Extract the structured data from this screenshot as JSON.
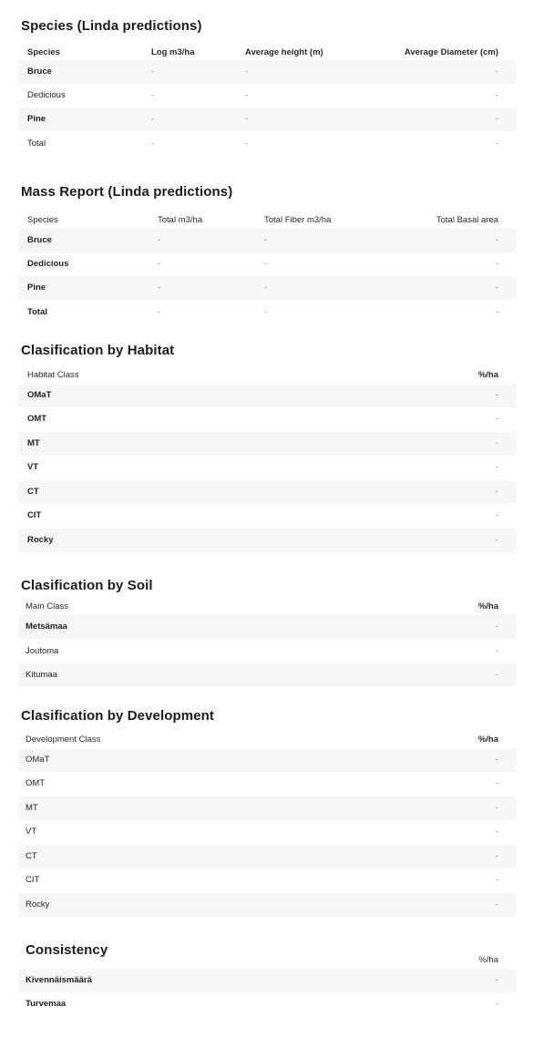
{
  "species": {
    "title": "Species (Linda predictions)",
    "headers": [
      "Species",
      "Log m3/ha",
      "Average height (m)",
      "Average Diameter (cm)"
    ],
    "rows": [
      {
        "label": "Bruce",
        "c1": "-",
        "c2": "-",
        "c3": "-"
      },
      {
        "label": "Dedicious",
        "c1": "-",
        "c2": "-",
        "c3": "-"
      },
      {
        "label": "Pine",
        "c1": "-",
        "c2": "-",
        "c3": "-"
      },
      {
        "label": "Total",
        "c1": "-",
        "c2": "-",
        "c3": "-"
      }
    ]
  },
  "mass": {
    "title": "Mass Report (Linda predictions)",
    "headers": [
      "Species",
      "Total m3/ha",
      "Total Fiber m3/ha",
      "Total Basal area"
    ],
    "rows": [
      {
        "label": "Bruce",
        "c1": "-",
        "c2": "-",
        "c3": "-"
      },
      {
        "label": "Dedicious",
        "c1": "-",
        "c2": "-",
        "c3": "-"
      },
      {
        "label": "Pine",
        "c1": "-",
        "c2": "-",
        "c3": "-"
      },
      {
        "label": "Total",
        "c1": "-",
        "c2": "-",
        "c3": "-"
      }
    ]
  },
  "habitat": {
    "title": "Clasification by Habitat",
    "headers": [
      "Habitat Class",
      "%/ha"
    ],
    "rows": [
      {
        "label": "OMaT",
        "value": "-"
      },
      {
        "label": "OMT",
        "value": "-"
      },
      {
        "label": "MT",
        "value": "-"
      },
      {
        "label": "VT",
        "value": "-"
      },
      {
        "label": "CT",
        "value": "-"
      },
      {
        "label": "CIT",
        "value": "-"
      },
      {
        "label": "Rocky",
        "value": "-"
      }
    ]
  },
  "soil": {
    "title": "Clasification by Soil",
    "headers": [
      "Main Class",
      "%/ha"
    ],
    "rows": [
      {
        "label": "Metsämaa",
        "value": "-"
      },
      {
        "label": "Joutoma",
        "value": "-"
      },
      {
        "label": "Kitumaa",
        "value": "-"
      }
    ]
  },
  "development": {
    "title": "Clasification by Development",
    "headers": [
      "Development Class",
      "%/ha"
    ],
    "rows": [
      {
        "label": "OMaT",
        "value": "-"
      },
      {
        "label": "OMT",
        "value": "-"
      },
      {
        "label": "MT",
        "value": "-"
      },
      {
        "label": "VT",
        "value": "-"
      },
      {
        "label": "CT",
        "value": "-"
      },
      {
        "label": "CIT",
        "value": "-"
      },
      {
        "label": "Rocky",
        "value": "-"
      }
    ]
  },
  "consistency": {
    "title": "Consistency",
    "headers": [
      "%/ha"
    ],
    "rows": [
      {
        "label": "Kivennäismäärä",
        "value": "-"
      },
      {
        "label": "Turvemaa",
        "value": "-"
      }
    ]
  }
}
